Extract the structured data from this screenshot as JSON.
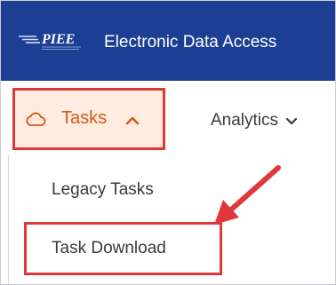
{
  "header": {
    "logo_text": "PIEE",
    "app_title": "Electronic Data Access"
  },
  "nav": {
    "tasks_label": "Tasks",
    "analytics_label": "Analytics"
  },
  "tasks_menu": {
    "items": [
      {
        "label": "Legacy Tasks"
      },
      {
        "label": "Task Download"
      }
    ]
  },
  "colors": {
    "header_bg": "#1c3f93",
    "tasks_active_text": "#d9581a",
    "tasks_active_bg": "#fdecdf",
    "highlight_red": "#e0373b"
  },
  "icons": {
    "tasks": "cloud-icon",
    "tasks_toggle": "chevron-up-icon",
    "analytics_toggle": "chevron-down-icon"
  }
}
